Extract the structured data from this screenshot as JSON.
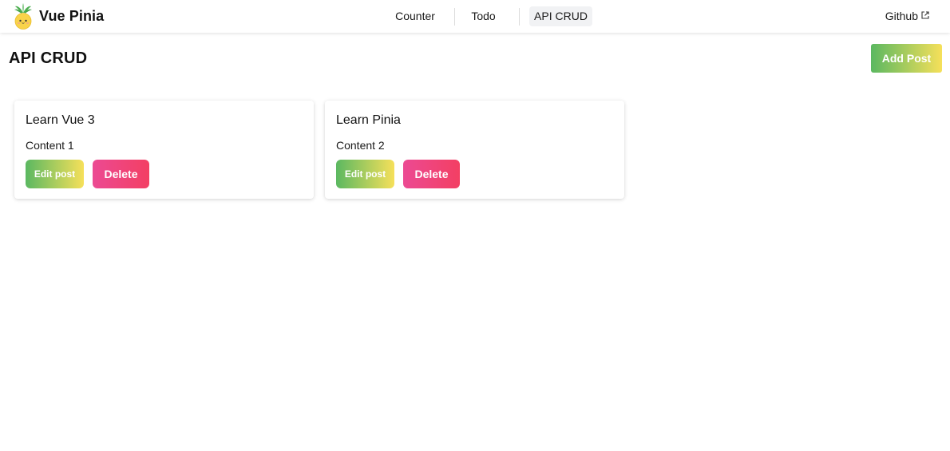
{
  "app": {
    "brand_name": "Vue Pinia"
  },
  "nav": {
    "links": [
      {
        "label": "Counter",
        "active": false
      },
      {
        "label": "Todo",
        "active": false
      },
      {
        "label": "API CRUD",
        "active": true
      }
    ],
    "github_label": "Github"
  },
  "page": {
    "title": "API CRUD",
    "add_post_label": "Add Post"
  },
  "posts": [
    {
      "title": "Learn Vue 3",
      "content": "Content 1",
      "edit_label": "Edit post",
      "delete_label": "Delete"
    },
    {
      "title": "Learn Pinia",
      "content": "Content 2",
      "edit_label": "Edit post",
      "delete_label": "Delete"
    }
  ],
  "icons": {
    "brand_logo": "pinia-pineapple-icon",
    "github_link": "external-link-icon"
  },
  "colors": {
    "primary_gradient_start": "#5bb861",
    "primary_gradient_end": "#f6e05a",
    "danger_gradient_start": "#ec4a93",
    "danger_gradient_end": "#f33f63",
    "active_tab_bg": "#f1f2f4"
  }
}
